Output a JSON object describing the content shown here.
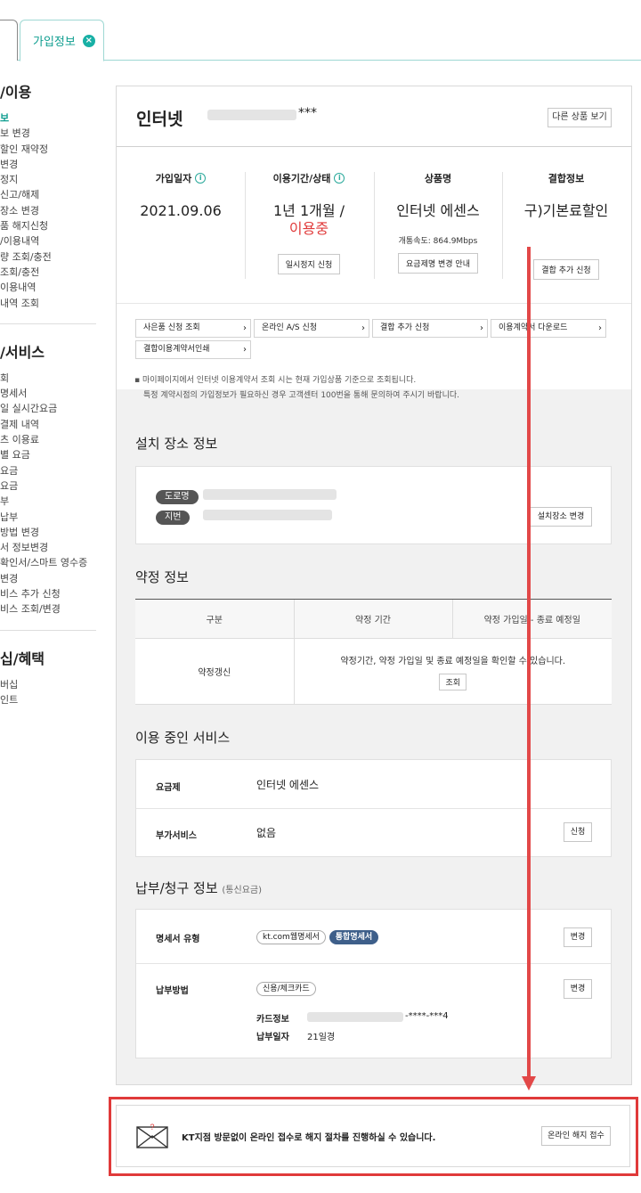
{
  "tab": {
    "label": "가입정보"
  },
  "sidebar": {
    "section1": {
      "title": "/이용",
      "items": [
        "보",
        "보 변경",
        "할인 재약정",
        "변경",
        "정지",
        "신고/해제",
        "장소 변경",
        "품 해지신청",
        "/이용내역",
        "량 조회/충전",
        "조회/충전",
        "이용내역",
        "내역 조회"
      ]
    },
    "section2": {
      "title": "/서비스",
      "items": [
        "회",
        "명세서",
        "일 실시간요금",
        "결제 내역",
        "츠 이용료",
        "별 요금",
        "요금",
        "요금",
        "부",
        "납부",
        "방법 변경",
        "서 정보변경",
        "확인서/스마트 영수증",
        "변경",
        "비스 추가 신청",
        "비스 조회/변경"
      ]
    },
    "section3": {
      "title": "십/혜택",
      "items": [
        "버십",
        "인트"
      ]
    }
  },
  "product": {
    "title": "인터넷",
    "masked_id": "***",
    "other_button": "다른 상품 보기"
  },
  "info": {
    "join_date": {
      "label": "가입일자",
      "value": "2021.09.06"
    },
    "period": {
      "label": "이용기간/상태",
      "value": "1년 1개월 /",
      "status": "이용중",
      "button": "일시정지 신청"
    },
    "product_name": {
      "label": "상품명",
      "value": "인터넷 에센스",
      "speed": "개통속도: 864.9Mbps",
      "button": "요금제명 변경 안내"
    },
    "bundle": {
      "label": "결합정보",
      "value": "구)기본료할인",
      "button": "결합 추가 신청"
    }
  },
  "links": [
    "사은품 신청 조회",
    "온라인 A/S 신청",
    "결합 추가 신청",
    "이용계약서 다운로드",
    "결합이용계약서인쇄"
  ],
  "notes": [
    "마이페이지에서 인터넷 이용계약서 조회 시는 현재 가입상품 기준으로 조회됩니다.",
    "특정 계약시점의 가입정보가 필요하신 경우 고객센터 100번을 통해 문의하여 주시기 바랍니다."
  ],
  "install": {
    "title": "설치 장소 정보",
    "road_label": "도로명",
    "lot_label": "지번",
    "button": "설치장소 변경"
  },
  "contract": {
    "title": "약정 정보",
    "headers": [
      "구분",
      "약정 기간",
      "약정 가입일 - 종료 예정일"
    ],
    "type": "약정갱신",
    "message": "약정기간, 약정 가입일 및 종료 예정일을 확인할 수 있습니다.",
    "button": "조회"
  },
  "services": {
    "title": "이용 중인 서비스",
    "plan_label": "요금제",
    "plan_value": "인터넷 에센스",
    "addon_label": "부가서비스",
    "addon_value": "없음",
    "addon_button": "신청"
  },
  "billing": {
    "title": "납부/청구 정보",
    "subtitle": "(통신요금)",
    "statement_label": "명세서 유형",
    "statement_tag1": "kt.com웹명세서",
    "statement_tag2": "통합명세서",
    "statement_button": "변경",
    "method_label": "납부방법",
    "method_tag": "신용/체크카드",
    "method_button": "변경",
    "card_label": "카드정보",
    "card_value": "-****-***4",
    "pay_day_label": "납부일자",
    "pay_day_value": "21일경"
  },
  "notice": {
    "message": "KT지점 방문없이 온라인 접수로 해지 절차를 진행하실 수 있습니다.",
    "button": "온라인 해지 접수"
  },
  "colors": {
    "accent": "#0f9e90",
    "status_red": "#e03a3a",
    "highlight": "#e03a3a",
    "tag_blue": "#3e5f8a"
  }
}
